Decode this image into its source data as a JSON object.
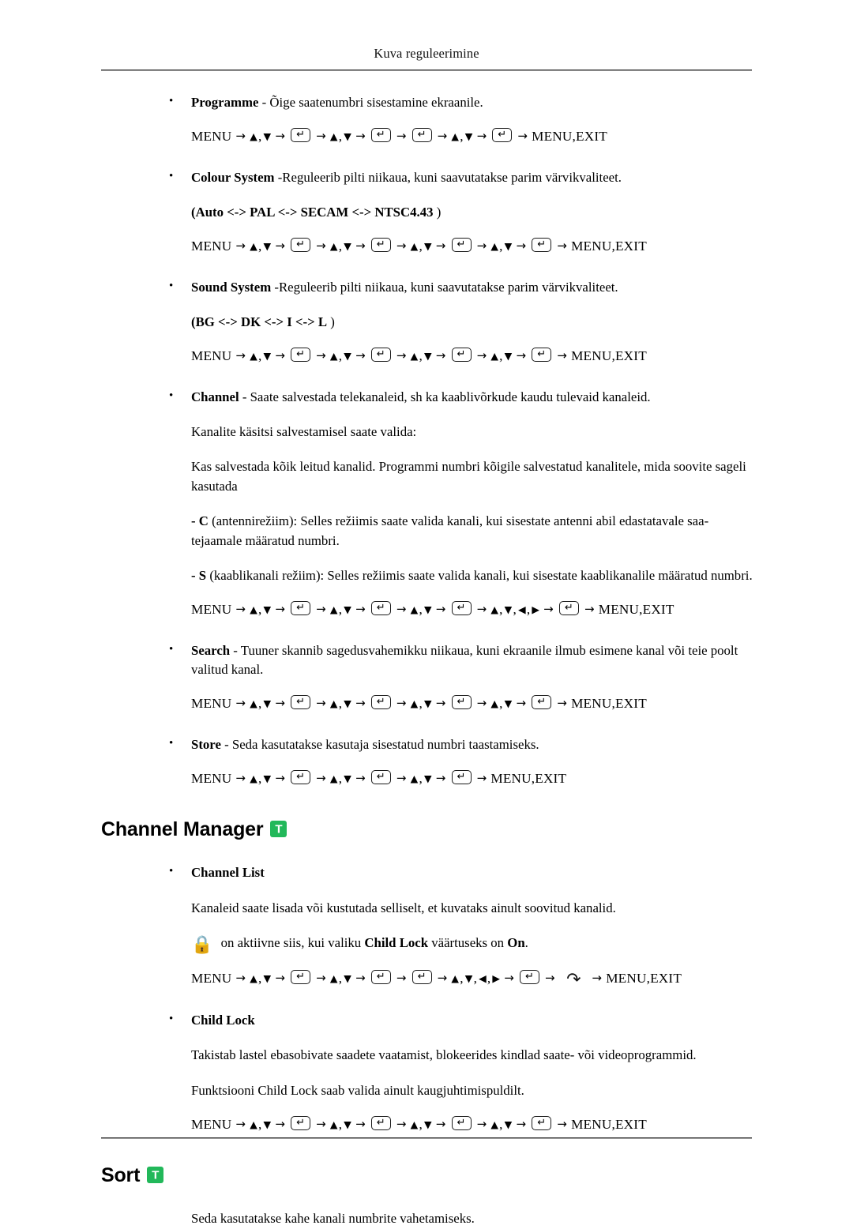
{
  "page": {
    "running_header": "Kuva reguleerimine",
    "accent_green": "#22b85a",
    "text_color": "#000000",
    "background": "#ffffff"
  },
  "glyphs": {
    "bullet": "•",
    "arrow_right": "→",
    "up_triangle": "▲",
    "down_triangle": "▼",
    "left_triangle": "◀",
    "right_triangle": "▶",
    "enter_key": "↵",
    "return_arrow": "↶",
    "padlock": "🔒",
    "comma": ","
  },
  "sequences": {
    "menu_label": "MENU",
    "exit_label": "MENU,EXIT"
  },
  "items": [
    {
      "id": "programme",
      "bold": "Programme",
      "rest": " - Õige saatenumbri sisestamine ekraanile.",
      "sequence": [
        "MENU",
        "arrow",
        "updown",
        "arrow",
        "enter",
        "arrow",
        "updown",
        "arrow",
        "enter",
        "arrow",
        "enter",
        "arrow",
        "updown",
        "arrow",
        "enter",
        "arrow",
        "EXIT"
      ]
    },
    {
      "id": "colour-system",
      "bold": "Colour System",
      "rest": " -Reguleerib pilti niikaua, kuni saavutatakse parim värvikvaliteet.",
      "options": "(Auto <-> PAL <-> SECAM <-> NTSC4.43 )",
      "options_parts": {
        "open": "(",
        "a": "Auto",
        "sep1": " <-> ",
        "b": "PAL",
        "sep2": " <-> ",
        "c": "SECAM",
        "sep3": " <-> ",
        "d": "NTSC4.43",
        "close": " )"
      }
    },
    {
      "id": "sound-system",
      "bold": "Sound System",
      "rest": " -Reguleerib pilti niikaua, kuni saavutatakse parim värvikvaliteet.",
      "options_parts": {
        "open": "(",
        "a": "BG",
        "sep1": " <-> ",
        "b": "DK",
        "sep2": " <-> ",
        "c": "I",
        "sep3": " <-> ",
        "d": "L",
        "close": " )"
      }
    },
    {
      "id": "channel",
      "bold": "Channel",
      "rest": " - Saate salvestada telekanaleid, sh ka kaablivõrkude kaudu tulevaid kanaleid.",
      "para1": "Kanalite käsitsi salvestamisel saate valida:",
      "para2": "Kas salvestada kõik leitud kanalid. Programmi numbri kõigile salvestatud kanalitele, mida soovite sageli kasutada",
      "para3_bold": "- C",
      "para3_rest": " (antennirežiim): Selles režiimis saate valida kanali, kui sisestate antenni abil edastatavale saa-tejaamale määratud numbri.",
      "para4_bold": "- S",
      "para4_rest": " (kaablikanali režiim): Selles režiimis saate valida kanali, kui sisestate kaablikanalile määratud numbri."
    },
    {
      "id": "search",
      "bold": "Search",
      "rest": " - Tuuner skannib sagedusvahemikku niikaua, kuni ekraanile ilmub esimene kanal või teie poolt valitud kanal."
    },
    {
      "id": "store",
      "bold": "Store",
      "rest": " - Seda kasutatakse kasutaja sisestatud numbri taastamiseks."
    }
  ],
  "channel_manager": {
    "heading": "Channel Manager",
    "badge_letter": "T",
    "channel_list_label": "Channel List",
    "channel_list_desc": "Kanaleid saate lisada või kustutada selliselt, et kuvataks ainult soovitud kanalid.",
    "lock_note_pre": " on aktiivne siis, kui valiku ",
    "lock_note_bold1": "Child Lock",
    "lock_note_mid": " väärtuseks on ",
    "lock_note_bold2": "On",
    "lock_note_end": ".",
    "child_lock_label": "Child Lock",
    "child_lock_desc1": "Takistab lastel ebasobivate saadete vaatamist, blokeerides kindlad saate- või videoprogrammid.",
    "child_lock_desc2": "Funktsiooni Child Lock saab valida ainult kaugjuhtimispuldilt."
  },
  "sort": {
    "heading": "Sort",
    "badge_letter": "T",
    "desc": "Seda kasutatakse kahe kanali numbrite vahetamiseks."
  }
}
